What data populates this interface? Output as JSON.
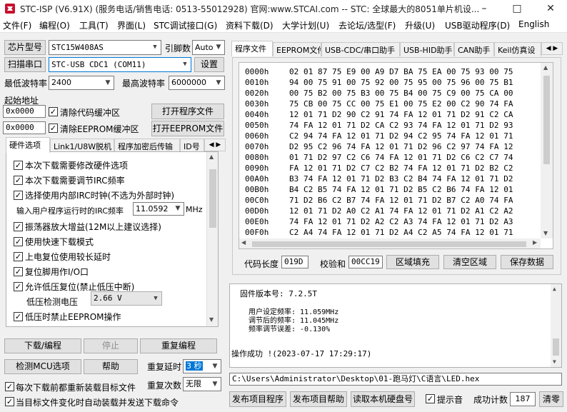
{
  "window": {
    "title": "STC-ISP (V6.91X) (服务电话/销售电话: 0513-55012928) 官网:www.STCAI.com  -- STC: 全球最大的8051单片机设..."
  },
  "menu": [
    "文件(F)",
    "编程(O)",
    "工具(T)",
    "界面(L)",
    "STC调试接口(G)",
    "资料下载(D)",
    "大学计划(U)",
    "去论坛/选型(F)",
    "升级(U)",
    "USB驱动程序(D)",
    "English"
  ],
  "left": {
    "chip_label": "芯片型号",
    "chip_value": "STC15W408AS",
    "pins_label": "引脚数",
    "pins_value": "Auto",
    "scan_label": "扫描串口",
    "port_value": "STC-USB CDC1 (COM11)",
    "settings_label": "设置",
    "min_baud_label": "最低波特率",
    "min_baud_value": "2400",
    "max_baud_label": "最高波特率",
    "max_baud_value": "6000000",
    "start_addr_label": "起始地址",
    "addr1": "0x0000",
    "clear_code_label": "清除代码缓冲区",
    "open_prog_label": "打开程序文件",
    "addr2": "0x0000",
    "clear_eeprom_label": "清除EEPROM缓冲区",
    "open_eeprom_label": "打开EEPROM文件",
    "tabs": [
      "硬件选项",
      "Link1/U8W脱机",
      "程序加密后传输",
      "ID号"
    ],
    "options": [
      "本次下载需要修改硬件选项",
      "本次下载需要调节IRC频率",
      "选择使用内部IRC时钟(不选为外部时钟)",
      "振荡器放大增益(12M以上建议选择)",
      "使用快速下载模式",
      "上电复位使用较长延时",
      "复位脚用作I/O口",
      "允许低压复位(禁止低压中断)",
      "低压时禁止EEPROM操作"
    ],
    "irc_label": "输入用户程序运行时的IRC频率",
    "irc_value": "11.0592",
    "irc_unit": "MHz",
    "low_volt_label": "低压检测电压",
    "low_volt_value": "2.66 V",
    "download_label": "下载/编程",
    "stop_label": "停止",
    "reprogram_label": "重复编程",
    "detect_label": "检测MCU选项",
    "help_label": "帮助",
    "repeat_delay_label": "重复延时",
    "repeat_delay_value": "3 秒",
    "repeat_count_label": "重复次数",
    "repeat_count_value": "无限",
    "reload_label": "每次下载前都重新装载目标文件",
    "auto_send_label": "当目标文件变化时自动装载并发送下载命令"
  },
  "right": {
    "tabs": [
      "程序文件",
      "EEPROM文件",
      "USB-CDC/串口助手",
      "USB-HID助手",
      "CAN助手",
      "Keil仿真设"
    ],
    "hex_rows": [
      {
        "addr": "0000h",
        "bytes": "02 01 87 75 E9 00 A9 D7 BA 75 EA 00 75 93 00 75"
      },
      {
        "addr": "0010h",
        "bytes": "94 00 75 91 00 75 92 00 75 95 00 75 96 00 75 B1"
      },
      {
        "addr": "0020h",
        "bytes": "00 75 B2 00 75 B3 00 75 B4 00 75 C9 00 75 CA 00"
      },
      {
        "addr": "0030h",
        "bytes": "75 CB 00 75 CC 00 75 E1 00 75 E2 00 C2 90 74 FA"
      },
      {
        "addr": "0040h",
        "bytes": "12 01 71 D2 90 C2 91 74 FA 12 01 71 D2 91 C2 CA"
      },
      {
        "addr": "0050h",
        "bytes": "74 FA 12 01 71 D2 CA C2 93 74 FA 12 01 71 D2 93"
      },
      {
        "addr": "0060h",
        "bytes": "C2 94 74 FA 12 01 71 D2 94 C2 95 74 FA 12 01 71"
      },
      {
        "addr": "0070h",
        "bytes": "D2 95 C2 96 74 FA 12 01 71 D2 96 C2 97 74 FA 12"
      },
      {
        "addr": "0080h",
        "bytes": "01 71 D2 97 C2 C6 74 FA 12 01 71 D2 C6 C2 C7 74"
      },
      {
        "addr": "0090h",
        "bytes": "FA 12 01 71 D2 C7 C2 B2 74 FA 12 01 71 D2 B2 C2"
      },
      {
        "addr": "00A0h",
        "bytes": "B3 74 FA 12 01 71 D2 B3 C2 B4 74 FA 12 01 71 D2"
      },
      {
        "addr": "00B0h",
        "bytes": "B4 C2 B5 74 FA 12 01 71 D2 B5 C2 B6 74 FA 12 01"
      },
      {
        "addr": "00C0h",
        "bytes": "71 D2 B6 C2 B7 74 FA 12 01 71 D2 B7 C2 A0 74 FA"
      },
      {
        "addr": "00D0h",
        "bytes": "12 01 71 D2 A0 C2 A1 74 FA 12 01 71 D2 A1 C2 A2"
      },
      {
        "addr": "00E0h",
        "bytes": "74 FA 12 01 71 D2 A2 C2 A3 74 FA 12 01 71 D2 A3"
      },
      {
        "addr": "00F0h",
        "bytes": "C2 A4 74 FA 12 01 71 D2 A4 C2 A5 74 FA 12 01 71"
      }
    ],
    "code_len_label": "代码长度",
    "code_len_value": "019D",
    "checksum_label": "校验和",
    "checksum_value": "00CC19",
    "fill_label": "区域填充",
    "clear_area_label": "清空区域",
    "save_label": "保存数据",
    "log": {
      "fw": "固件版本号: 7.2.5T",
      "user_freq": "用户设定频率: 11.059MHz",
      "adjusted_freq": "调节后的频率: 11.045MHz",
      "freq_error": "频率调节误差: -0.130%",
      "success": "操作成功 !(2023-07-17 17:29:17)"
    },
    "path": "C:\\Users\\Administrator\\Desktop\\01-跑马灯\\C语言\\LED.hex",
    "publish_prog_label": "发布项目程序",
    "publish_help_label": "发布项目帮助",
    "read_disk_label": "读取本机硬盘号",
    "beep_label": "提示音",
    "success_count_label": "成功计数",
    "success_count_value": "187",
    "clear_label": "清零"
  }
}
